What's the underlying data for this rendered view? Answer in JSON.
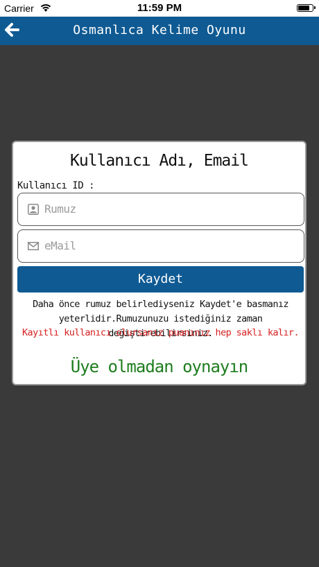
{
  "status_bar": {
    "carrier": "Carrier",
    "time": "11:59 PM"
  },
  "nav": {
    "title": "Osmanlıca Kelime Oyunu",
    "back_icon": "arrow-left-icon"
  },
  "colors": {
    "nav_bg": "#0f5a93",
    "page_bg": "#3a3a3a",
    "warning": "#d62020",
    "guest_link": "#1e7d1e"
  },
  "dialog": {
    "title": "Kullanıcı Adı, Email",
    "user_id_label": "Kullanıcı ID :",
    "nickname_placeholder": "Rumuz",
    "email_placeholder": "eMail",
    "save_label": "Kaydet",
    "info_text": "Daha önce rumuz belirlediyseniz Kaydet'e basmanız yeterlidir.Rumuzunuzu istediğiniz zaman değiştirebilirsiniz.",
    "warning_text": "Kayıtlı kullanıcı olursanız puanınız hep saklı kalır.",
    "guest_label": "Üye olmadan oynayın"
  }
}
